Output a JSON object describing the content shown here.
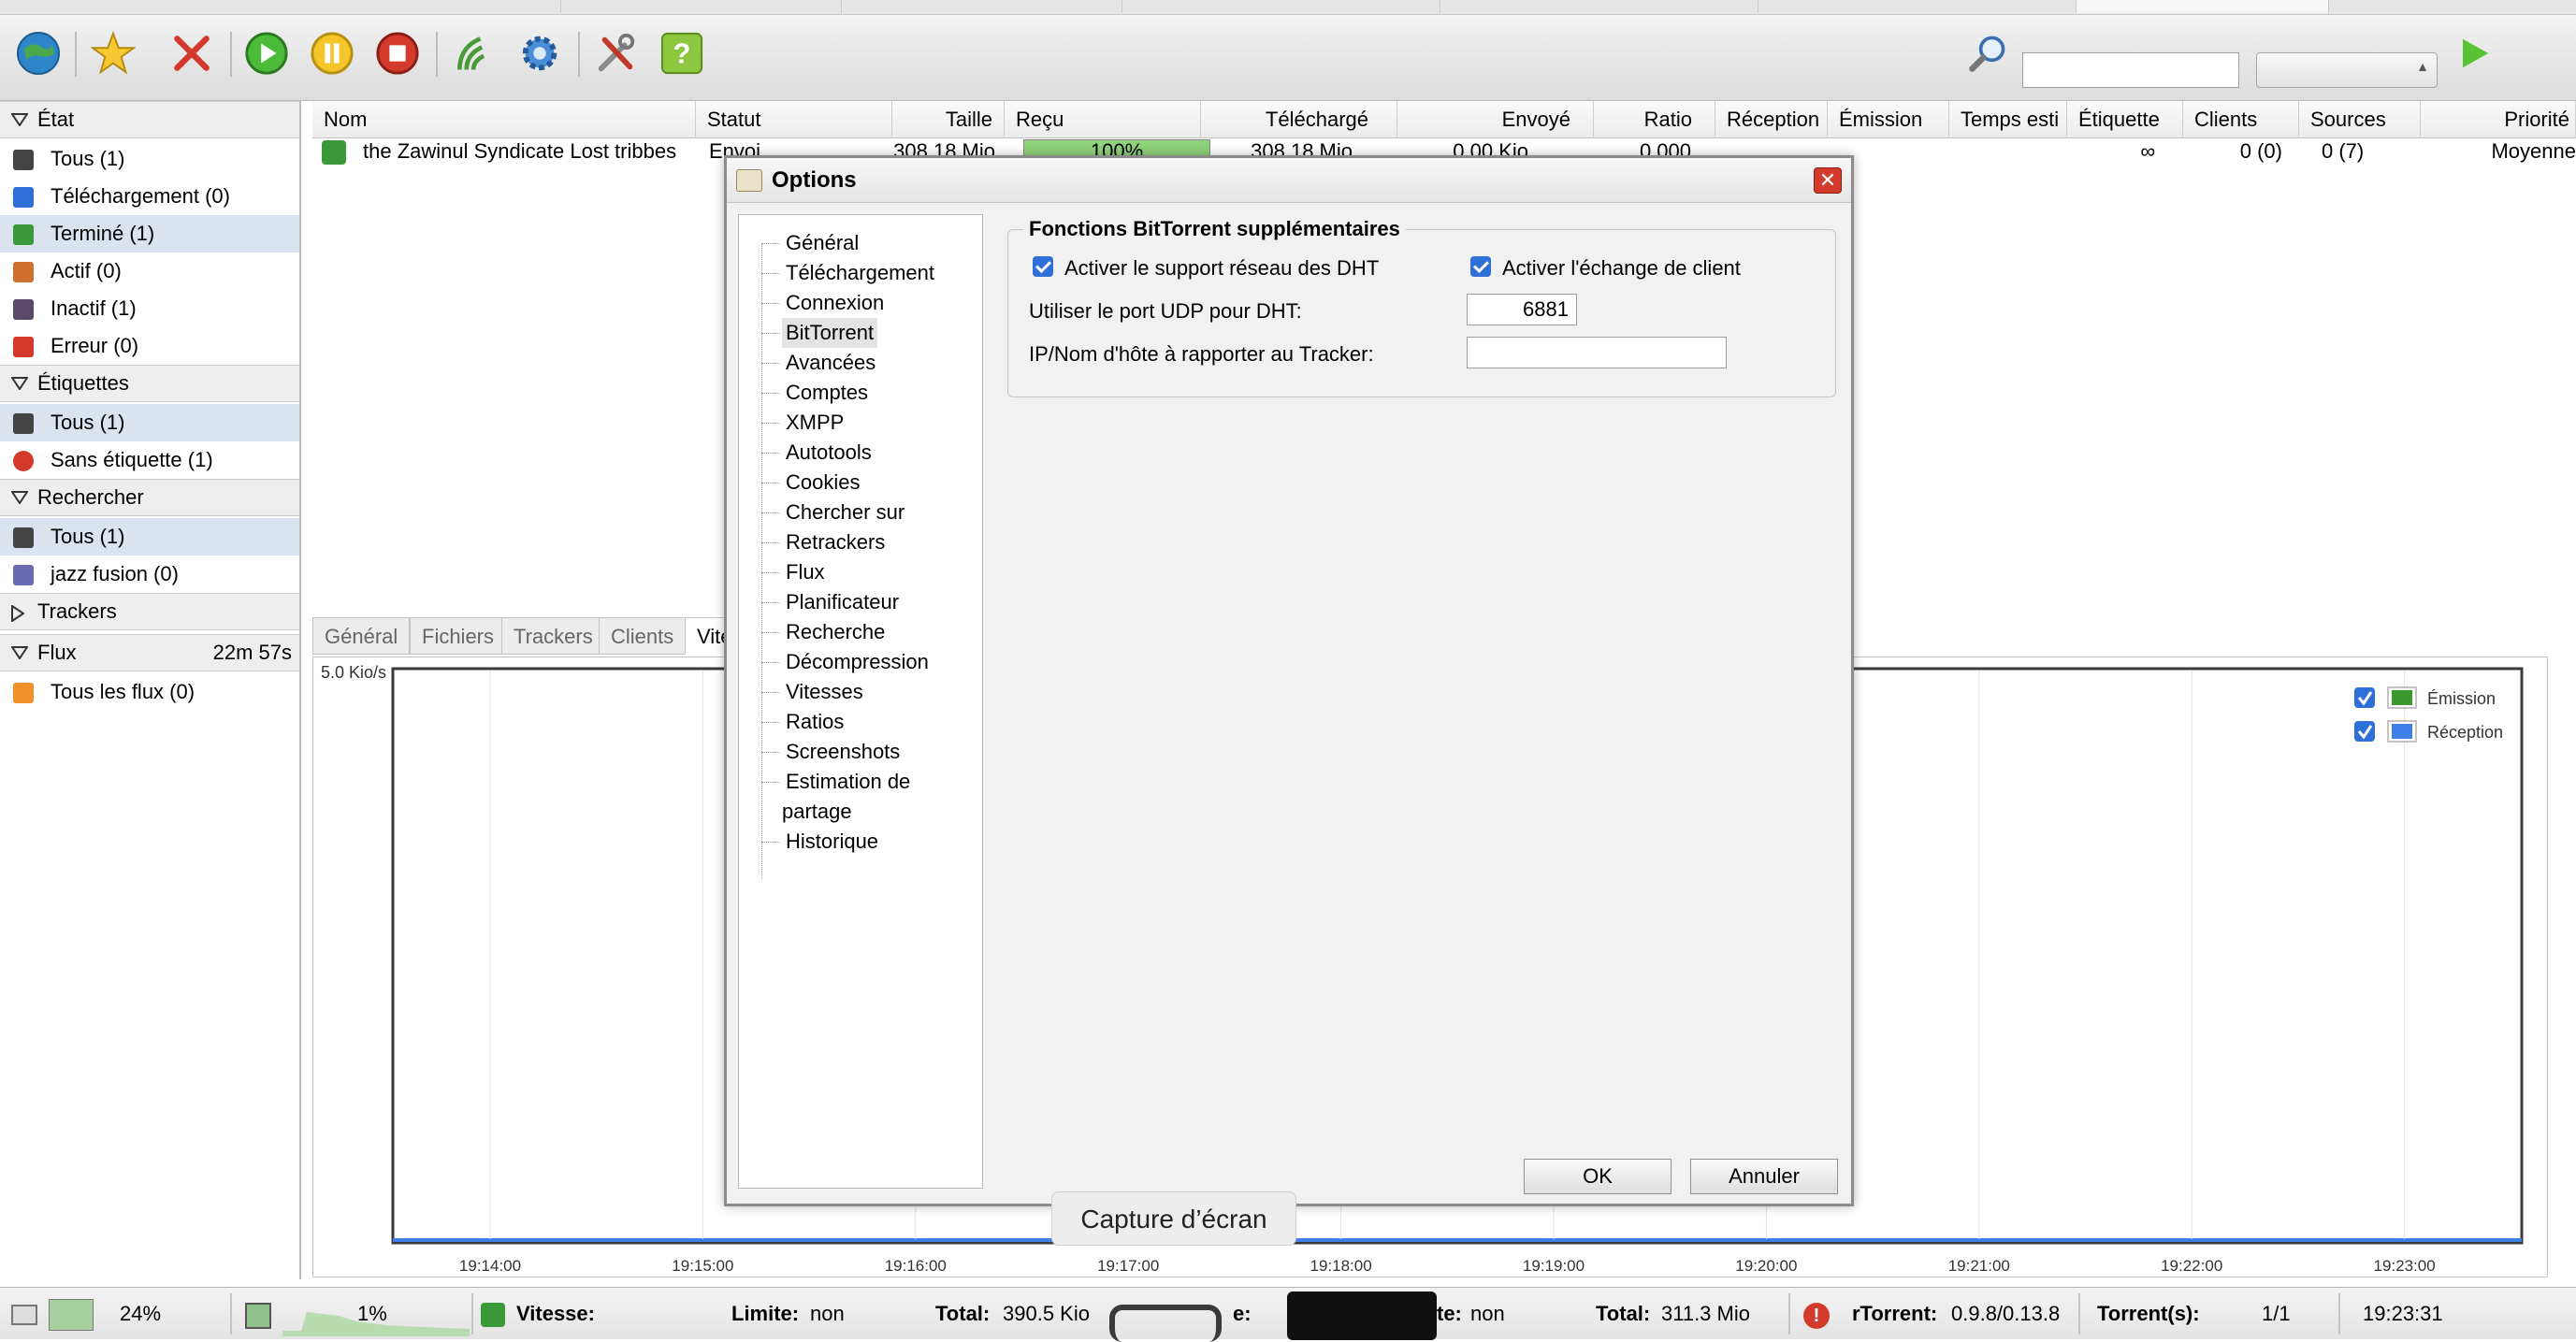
{
  "toolbar": {
    "buttons": [
      "globe-icon",
      "star-icon",
      "delete-icon",
      "start-icon",
      "pause-icon",
      "stop-icon",
      "rss-icon",
      "settings-icon",
      "tools-icon",
      "help-icon"
    ]
  },
  "sidebar": {
    "etat": {
      "title": "État",
      "items": [
        {
          "label": "Tous (1)",
          "color": "#444444"
        },
        {
          "label": "Téléchargement (0)",
          "color": "#2f6fd8"
        },
        {
          "label": "Terminé (1)",
          "color": "#3a9a3a"
        },
        {
          "label": "Actif (0)",
          "color": "#d07030"
        },
        {
          "label": "Inactif (1)",
          "color": "#5a4a6a"
        },
        {
          "label": "Erreur (0)",
          "color": "#d33a2c"
        }
      ]
    },
    "etiquettes": {
      "title": "Étiquettes",
      "items": [
        {
          "label": "Tous (1)",
          "color": "#444444"
        },
        {
          "label": "Sans étiquette (1)",
          "color": "#d33a2c"
        }
      ]
    },
    "rechercher": {
      "title": "Rechercher",
      "items": [
        {
          "label": "Tous (1)",
          "color": "#444444"
        },
        {
          "label": "jazz fusion (0)",
          "color": "#6a6ab0"
        }
      ]
    },
    "trackers": {
      "title": "Trackers"
    },
    "flux": {
      "title": "Flux",
      "timer": "22m 57s",
      "items": [
        {
          "label": "Tous les flux (0)",
          "color": "#f0902a"
        }
      ]
    }
  },
  "grid": {
    "columns": [
      "Nom",
      "Statut",
      "Taille",
      "Reçu",
      "Téléchargé",
      "Envoyé",
      "Ratio",
      "Réception",
      "Émission",
      "Temps esti",
      "Étiquette",
      "Clients",
      "Sources",
      "Priorité"
    ],
    "row": {
      "nom": "the Zawinul Syndicate Lost tribbes",
      "statut": "Envoi",
      "taille": "308.18 Mio",
      "recu": "100%",
      "recu_fraction": 1.0,
      "telecharge": "308.18 Mio",
      "envoye": "0.00 Kio",
      "ratio": "0.000",
      "temps": "∞",
      "clients": "0 (0)",
      "sources": "0 (7)",
      "priorite": "Moyenne"
    }
  },
  "tabs": [
    "Général",
    "Fichiers",
    "Trackers",
    "Clients",
    "Vitesse"
  ],
  "speed_chart": {
    "ylabel_top": "5.0 Kio/s",
    "x_ticks": [
      "19:14:00",
      "19:15:00",
      "19:16:00",
      "19:17:00",
      "19:18:00",
      "19:19:00",
      "19:20:00",
      "19:21:00",
      "19:22:00",
      "19:23:00"
    ],
    "legend": [
      {
        "name": "Émission",
        "color": "#3b9a2e"
      },
      {
        "name": "Réception",
        "color": "#3f7fe8"
      }
    ]
  },
  "dialog": {
    "title": "Options",
    "nav": [
      "Général",
      "Téléchargement",
      "Connexion",
      "BitTorrent",
      "Avancées",
      "Comptes",
      "XMPP",
      "Autotools",
      "Cookies",
      "Chercher sur",
      "Retrackers",
      "Flux",
      "Planificateur",
      "Recherche",
      "Décompression",
      "Vitesses",
      "Ratios",
      "Screenshots",
      "Estimation de",
      "partage",
      "Historique"
    ],
    "section_title": "Fonctions BitTorrent supplémentaires",
    "dht_label": "Activer le support réseau des DHT",
    "pex_label": "Activer l'échange de client",
    "udp_label": "Utiliser le port UDP pour DHT:",
    "udp_value": "6881",
    "ip_label": "IP/Nom d'hôte à rapporter au Tracker:",
    "ip_value": "",
    "ok": "OK",
    "cancel": "Annuler"
  },
  "tooltip": "Capture d’écran",
  "statusbar": {
    "disk": "24%",
    "mem": "1%",
    "dl_label": "Vitesse:",
    "dl_limit_label": "Limite:",
    "dl_limit_value": "non",
    "dl_total_label": "Total:",
    "dl_total_value": "390.5 Kio",
    "ul_limit_tail": "te:",
    "ul_limit_value": "non",
    "ul_total_label": "Total:",
    "ul_total_value": "311.3 Mio",
    "rtorrent_label": "rTorrent:",
    "rtorrent_value": "0.9.8/0.13.8",
    "torrents_label": "Torrent(s):",
    "torrents_value": "1/1",
    "time": "19:23:31"
  }
}
